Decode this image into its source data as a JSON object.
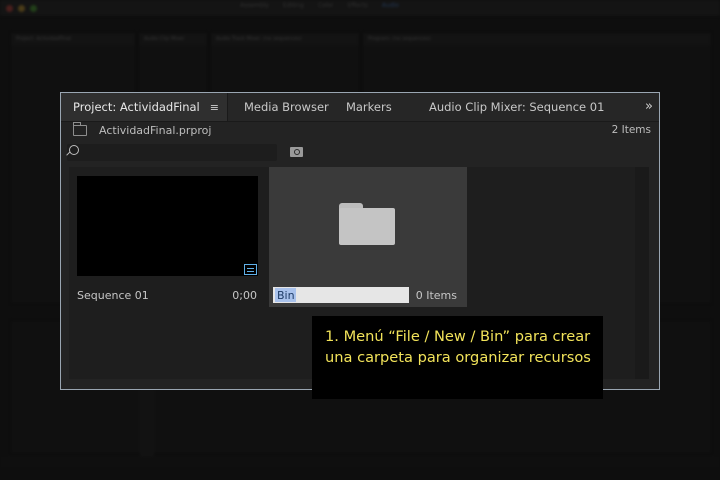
{
  "app": {
    "workspace_tabs": [
      "Assembly",
      "Editing",
      "Color",
      "Effects",
      "Audio"
    ],
    "active_workspace": "Audio",
    "bg_panels": {
      "project_tab": "Project: ActividadFinal",
      "audio_clip_mixer_tab": "Audio Clip Mixer",
      "audio_track_mixer_tab": "Audio Track Mixer: (no sequences)",
      "program_tab": "Program: (no sequences)"
    }
  },
  "project_panel": {
    "tabs": [
      {
        "label": "Project: ActividadFinal",
        "active": true
      },
      {
        "label": "Media Browser"
      },
      {
        "label": "Markers"
      },
      {
        "label": "Audio Clip Mixer: Sequence 01"
      }
    ],
    "menu_glyph": "≡",
    "overflow_glyph": "»",
    "project_file": "ActividadFinal.prproj",
    "item_count": "2 Items",
    "search": {
      "value": "",
      "placeholder": ""
    },
    "items": [
      {
        "type": "sequence",
        "name": "Sequence 01",
        "duration": "0;00"
      },
      {
        "type": "bin",
        "name": "Bin",
        "count": "0 Items",
        "editing": true
      }
    ]
  },
  "annotation": {
    "text": "1. Menú “File / New / Bin” para crear una carpeta para organizar recursos",
    "color": "#f2e35a"
  }
}
